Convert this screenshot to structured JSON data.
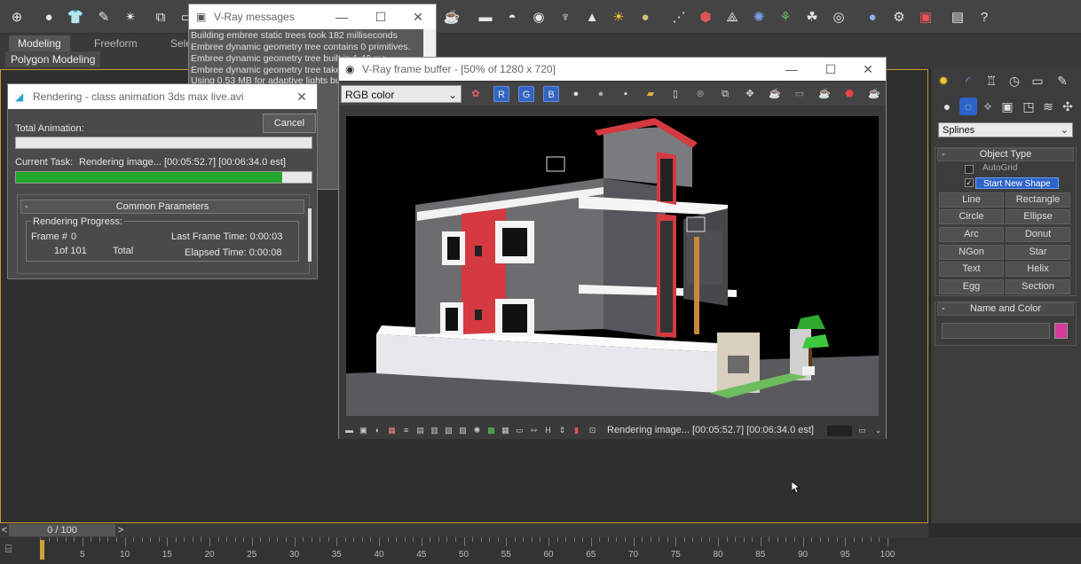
{
  "ribbon": {
    "tabs": [
      "Modeling",
      "Freeform",
      "Sele"
    ],
    "poly_label": "Polygon Modeling"
  },
  "vray_messages": {
    "title": "V-Ray messages",
    "lines": [
      "Building embree static trees took 182 milliseconds",
      "Embree dynamic geometry tree contains 0 primitives.",
      "Embree dynamic geometry tree built in 1.40 ms",
      "Embree dynamic geometry tree takes",
      "Using 0.53 MB for adaptive lights buff"
    ]
  },
  "render_dialog": {
    "title": "Rendering - class animation 3ds max live.avi",
    "cancel_label": "Cancel",
    "total_animation_label": "Total Animation:",
    "current_task_label": "Current Task:",
    "current_task_value": "Rendering image... [00:05:52.7] [00:06:34.0 est]",
    "current_task_progress": 0.9,
    "total_animation_progress": 0,
    "common_params_label": "Common Parameters",
    "rendering_progress_label": "Rendering Progress:",
    "frame_label": "Frame #",
    "frame_value": "0",
    "frame_count": "1of 101",
    "total_label": "Total",
    "last_frame_label": "Last Frame Time: 0:00:03",
    "elapsed_label": "Elapsed Time: 0:00:08"
  },
  "vfb": {
    "title": "V-Ray frame buffer - [50% of 1280 x 720]",
    "channel": "RGB color",
    "r_label": "R",
    "g_label": "G",
    "b_label": "B",
    "status_text": "Rendering image... [00:05:52.7] [00:06:34.0 est]"
  },
  "command_panel": {
    "category": "Splines",
    "object_type_label": "Object Type",
    "autogrid_label": "AutoGrid",
    "start_new_shape_label": "Start New Shape",
    "buttons": [
      "Line",
      "Rectangle",
      "Circle",
      "Ellipse",
      "Arc",
      "Donut",
      "NGon",
      "Star",
      "Text",
      "Helix",
      "Egg",
      "Section"
    ],
    "name_color_label": "Name and Color",
    "color": "#d63a9a"
  },
  "time_slider": {
    "frame_indicator": "0 / 100",
    "prev_label": "<",
    "next_label": ">"
  },
  "track_bar": {
    "ticks": [
      "5",
      "10",
      "15",
      "20",
      "25",
      "30",
      "35",
      "40",
      "45",
      "50",
      "55",
      "60",
      "65",
      "70",
      "75",
      "80",
      "85",
      "90",
      "95",
      "100"
    ]
  },
  "colors": {
    "viewport_border": "#c79a2b",
    "progress_green": "#1fa82c",
    "active_blue": "#2d64c9"
  }
}
